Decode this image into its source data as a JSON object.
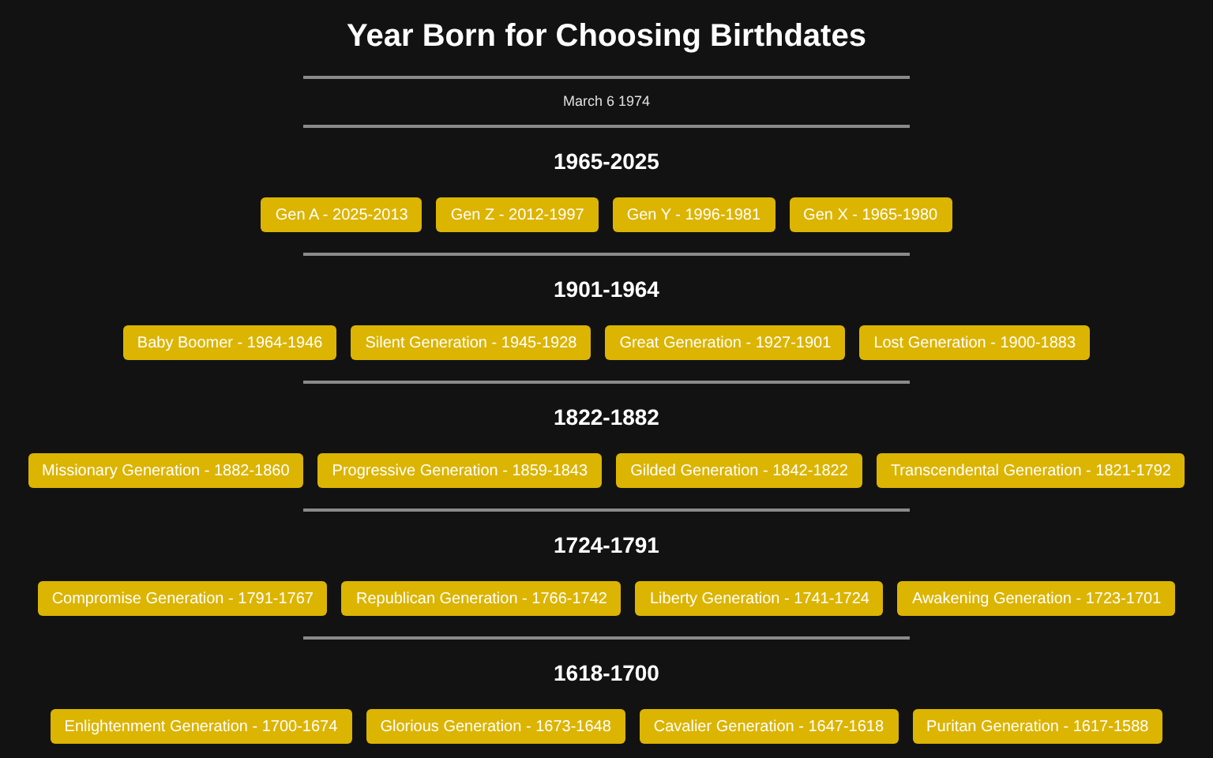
{
  "title": "Year Born for Choosing Birthdates",
  "date": "March 6 1974",
  "sections": [
    {
      "heading": "1965-2025",
      "buttons": [
        "Gen A - 2025-2013",
        "Gen Z - 2012-1997",
        "Gen Y - 1996-1981",
        "Gen X - 1965-1980"
      ]
    },
    {
      "heading": "1901-1964",
      "buttons": [
        "Baby Boomer - 1964-1946",
        "Silent Generation - 1945-1928",
        "Great Generation - 1927-1901",
        "Lost Generation - 1900-1883"
      ]
    },
    {
      "heading": "1822-1882",
      "buttons": [
        "Missionary Generation - 1882-1860",
        "Progressive Generation - 1859-1843",
        "Gilded Generation - 1842-1822",
        "Transcendental Generation - 1821-1792"
      ]
    },
    {
      "heading": "1724-1791",
      "buttons": [
        "Compromise Generation - 1791-1767",
        "Republican Generation - 1766-1742",
        "Liberty Generation - 1741-1724",
        "Awakening Generation - 1723-1701"
      ]
    },
    {
      "heading": "1618-1700",
      "buttons": [
        "Enlightenment Generation - 1700-1674",
        "Glorious Generation - 1673-1648",
        "Cavalier Generation - 1647-1618",
        "Puritan Generation - 1617-1588"
      ]
    }
  ]
}
